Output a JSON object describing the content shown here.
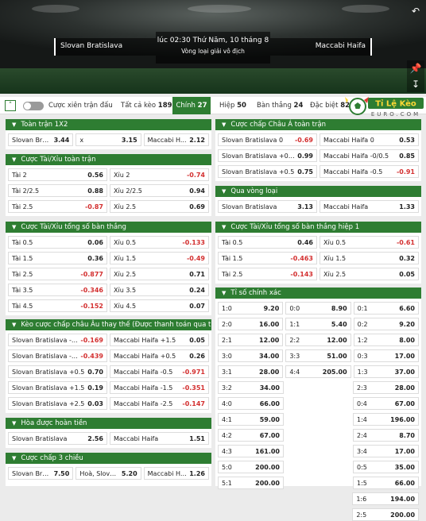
{
  "match": {
    "home": "Slovan Bratislava",
    "away": "Maccabi Haifa",
    "time": "lúc 02:30 Thứ Năm, 10 tháng 8",
    "league": "Vòng loại giải vô địch",
    "back_icon": "back-arrow-icon",
    "pin_icon": "pin-icon",
    "download_icon": "download-icon"
  },
  "nav": {
    "parlay_label": "Cược xiên trận đấu",
    "all_label": "Tất cả kèo",
    "all_count": "189",
    "main_label": "Chính",
    "main_count": "27",
    "half_label": "Hiệp",
    "half_count": "50",
    "goals_label": "Bàn thắng",
    "goals_count": "24",
    "special_label": "Đặc biệt",
    "special_count": "82"
  },
  "logo": {
    "title": "Tỉ Lệ Kèo",
    "sub": "EURO.COM"
  },
  "sections": {
    "s1": {
      "title": "Toàn trận 1X2",
      "rows": [
        [
          [
            "Slovan Bra...",
            "3.44"
          ],
          [
            "x",
            "3.15"
          ],
          [
            "Maccabi H...",
            "2.12"
          ]
        ]
      ]
    },
    "s2": {
      "title": "Cược Tài/Xỉu toàn trận",
      "rows": [
        [
          [
            "Tài 2",
            "0.56"
          ],
          [
            "Xỉu 2",
            "-0.74"
          ]
        ],
        [
          [
            "Tài 2/2.5",
            "0.88"
          ],
          [
            "Xỉu 2/2.5",
            "0.94"
          ]
        ],
        [
          [
            "Tài 2.5",
            "-0.87"
          ],
          [
            "Xỉu 2.5",
            "0.69"
          ]
        ]
      ]
    },
    "s3": {
      "title": "Cược Tài/Xỉu tổng số bàn thắng",
      "rows": [
        [
          [
            "Tài 0.5",
            "0.06"
          ],
          [
            "Xỉu 0.5",
            "-0.133"
          ]
        ],
        [
          [
            "Tài 1.5",
            "0.36"
          ],
          [
            "Xỉu 1.5",
            "-0.49"
          ]
        ],
        [
          [
            "Tài 2.5",
            "-0.877"
          ],
          [
            "Xỉu 2.5",
            "0.71"
          ]
        ],
        [
          [
            "Tài 3.5",
            "-0.346"
          ],
          [
            "Xỉu 3.5",
            "0.24"
          ]
        ],
        [
          [
            "Tài 4.5",
            "-0.152"
          ],
          [
            "Xỉu 4.5",
            "0.07"
          ]
        ]
      ]
    },
    "s4": {
      "title": "Kèo cược chấp châu Âu thay thế (Được thanh toán qua trên tỷ...",
      "rows": [
        [
          [
            "Slovan Bratislava -1.5",
            "-0.169"
          ],
          [
            "Maccabi Haifa +1.5",
            "0.05"
          ]
        ],
        [
          [
            "Slovan Bratislava -0.5",
            "-0.439"
          ],
          [
            "Maccabi Haifa +0.5",
            "0.26"
          ]
        ],
        [
          [
            "Slovan Bratislava +0.5",
            "0.70"
          ],
          [
            "Maccabi Haifa -0.5",
            "-0.971"
          ]
        ],
        [
          [
            "Slovan Bratislava +1.5",
            "0.19"
          ],
          [
            "Maccabi Haifa -1.5",
            "-0.351"
          ]
        ],
        [
          [
            "Slovan Bratislava +2.5",
            "0.03"
          ],
          [
            "Maccabi Haifa -2.5",
            "-0.147"
          ]
        ]
      ]
    },
    "s5": {
      "title": "Hòa được hoàn tiền",
      "rows": [
        [
          [
            "Slovan Bratislava",
            "2.56"
          ],
          [
            "Maccabi Haifa",
            "1.51"
          ]
        ]
      ]
    },
    "s6": {
      "title": "Cược chấp 3 chiều",
      "rows": [
        [
          [
            "Slovan Brat... -1",
            "7.50"
          ],
          [
            "Hoà, Slova... -1",
            "5.20"
          ],
          [
            "Maccabi H... +1",
            "1.26"
          ]
        ]
      ]
    },
    "s7": {
      "title": "Cược chấp Châu Á toàn trận",
      "rows": [
        [
          [
            "Slovan Bratislava 0",
            "-0.69"
          ],
          [
            "Maccabi Haifa 0",
            "0.53"
          ]
        ],
        [
          [
            "Slovan Bratislava +0/0.5",
            "0.99"
          ],
          [
            "Maccabi Haifa -0/0.5",
            "0.85"
          ]
        ],
        [
          [
            "Slovan Bratislava +0.5",
            "0.75"
          ],
          [
            "Maccabi Haifa -0.5",
            "-0.91"
          ]
        ]
      ]
    },
    "s8": {
      "title": "Qua vòng loại",
      "rows": [
        [
          [
            "Slovan Bratislava",
            "3.13"
          ],
          [
            "Maccabi Haifa",
            "1.33"
          ]
        ]
      ]
    },
    "s9": {
      "title": "Cược Tài/Xỉu tổng số bàn thắng hiệp 1",
      "rows": [
        [
          [
            "Tài 0.5",
            "0.46"
          ],
          [
            "Xỉu 0.5",
            "-0.61"
          ]
        ],
        [
          [
            "Tài 1.5",
            "-0.463"
          ],
          [
            "Xỉu 1.5",
            "0.32"
          ]
        ],
        [
          [
            "Tài 2.5",
            "-0.143"
          ],
          [
            "Xỉu 2.5",
            "0.05"
          ]
        ]
      ]
    },
    "s10": {
      "title": "Tỉ số chính xác",
      "rows": [
        [
          [
            "1:0",
            "9.20"
          ],
          [
            "0:0",
            "8.90"
          ],
          [
            "0:1",
            "6.60"
          ]
        ],
        [
          [
            "2:0",
            "16.00"
          ],
          [
            "1:1",
            "5.40"
          ],
          [
            "0:2",
            "9.20"
          ]
        ],
        [
          [
            "2:1",
            "12.00"
          ],
          [
            "2:2",
            "12.00"
          ],
          [
            "1:2",
            "8.00"
          ]
        ],
        [
          [
            "3:0",
            "34.00"
          ],
          [
            "3:3",
            "51.00"
          ],
          [
            "0:3",
            "17.00"
          ]
        ],
        [
          [
            "3:1",
            "28.00"
          ],
          [
            "4:4",
            "205.00"
          ],
          [
            "1:3",
            "37.00"
          ]
        ],
        [
          [
            "3:2",
            "34.00"
          ],
          [
            "",
            ""
          ],
          [
            "2:3",
            "28.00"
          ]
        ],
        [
          [
            "4:0",
            "66.00"
          ],
          [
            "",
            ""
          ],
          [
            "0:4",
            "67.00"
          ]
        ],
        [
          [
            "4:1",
            "59.00"
          ],
          [
            "",
            ""
          ],
          [
            "1:4",
            "196.00"
          ]
        ],
        [
          [
            "4:2",
            "67.00"
          ],
          [
            "",
            ""
          ],
          [
            "2:4",
            "8.70"
          ]
        ],
        [
          [
            "4:3",
            "161.00"
          ],
          [
            "",
            ""
          ],
          [
            "3:4",
            "17.00"
          ]
        ],
        [
          [
            "5:0",
            "200.00"
          ],
          [
            "",
            ""
          ],
          [
            "0:5",
            "35.00"
          ]
        ],
        [
          [
            "5:1",
            "200.00"
          ],
          [
            "",
            ""
          ],
          [
            "1:5",
            "66.00"
          ]
        ],
        [
          [
            "",
            ""
          ],
          [
            "",
            ""
          ],
          [
            "1:6",
            "194.00"
          ]
        ],
        [
          [
            "",
            ""
          ],
          [
            "",
            ""
          ],
          [
            "2:5",
            "200.00"
          ]
        ]
      ]
    }
  },
  "colors": {
    "green": "#2e7d32",
    "negative": "#d32f2f"
  }
}
